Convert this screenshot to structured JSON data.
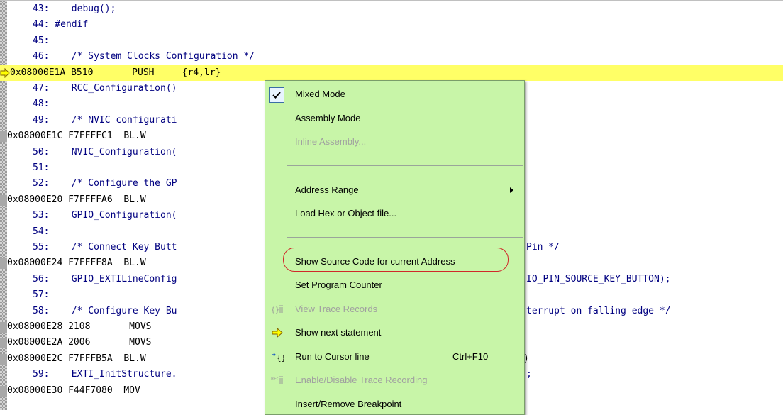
{
  "editor": {
    "lines": [
      {
        "kind": "src",
        "text": "43:    debug();"
      },
      {
        "kind": "src",
        "text": "44: #endif"
      },
      {
        "kind": "src",
        "text": "45:"
      },
      {
        "kind": "src",
        "text": "46:    /* System Clocks Configuration */"
      },
      {
        "kind": "cur",
        "text": "0x08000E1A B510       PUSH     {r4,lr}"
      },
      {
        "kind": "src",
        "text": "47:    RCC_Configuration()"
      },
      {
        "kind": "src",
        "text": "48:"
      },
      {
        "kind": "src",
        "text": "49:    /* NVIC configurati"
      },
      {
        "kind": "asm",
        "text": "0x08000E1C F7FFFFC1  BL.W"
      },
      {
        "kind": "src",
        "text": "50:    NVIC_Configuration("
      },
      {
        "kind": "src",
        "text": "51:"
      },
      {
        "kind": "src",
        "text": "52:    /* Configure the GP"
      },
      {
        "kind": "asm",
        "text": "0x08000E20 F7FFFFA6  BL.W"
      },
      {
        "kind": "src",
        "text": "53:    GPIO_Configuration("
      },
      {
        "kind": "src",
        "text": "54:"
      },
      {
        "kind": "src",
        "text": "55:    /* Connect Key Butt",
        "tail": "Pin */"
      },
      {
        "kind": "asm",
        "text": "0x08000E24 F7FFFF8A  BL.W"
      },
      {
        "kind": "src",
        "text": "56:    GPIO_EXTILineConfig",
        "tail": "IO_PIN_SOURCE_KEY_BUTTON);"
      },
      {
        "kind": "src",
        "text": "57:"
      },
      {
        "kind": "src",
        "text": "58:    /* Configure Key Bu",
        "tail": "terrupt on falling edge */"
      },
      {
        "kind": "asm",
        "text": "0x08000E28 2108       MOVS"
      },
      {
        "kind": "asm",
        "text": "0x08000E2A 2006       MOVS"
      },
      {
        "kind": "asm",
        "text": "0x08000E2C F7FFFB5A  BL.W",
        "tail": ")"
      },
      {
        "kind": "src",
        "text": "59:    EXTI_InitStructure.",
        "tail": ";"
      },
      {
        "kind": "asm",
        "text": "0x08000E30 F44F7080  MOV"
      }
    ]
  },
  "menu": {
    "items": [
      {
        "type": "item",
        "label": "Mixed Mode",
        "checked": true,
        "enabled": true
      },
      {
        "type": "item",
        "label": "Assembly Mode",
        "enabled": true
      },
      {
        "type": "item",
        "label": "Inline Assembly...",
        "enabled": false
      },
      {
        "type": "sep"
      },
      {
        "type": "item",
        "label": "Address Range",
        "submenu": true,
        "enabled": true
      },
      {
        "type": "item",
        "label": "Load Hex or Object file...",
        "enabled": true
      },
      {
        "type": "sep"
      },
      {
        "type": "item",
        "label": "Show Source Code for current Address",
        "enabled": true,
        "circled": true
      },
      {
        "type": "item",
        "label": "Set Program Counter",
        "enabled": true
      },
      {
        "type": "item",
        "label": "View Trace Records",
        "icon": "trace-records-icon",
        "enabled": false
      },
      {
        "type": "item",
        "label": "Show next statement",
        "icon": "next-statement-arrow-icon",
        "enabled": true
      },
      {
        "type": "item",
        "label": "Run to Cursor line",
        "icon": "run-to-cursor-icon",
        "shortcut": "Ctrl+F10",
        "enabled": true
      },
      {
        "type": "item",
        "label": "Enable/Disable Trace Recording",
        "icon": "trace-recording-icon",
        "enabled": false
      },
      {
        "type": "item",
        "label": "Insert/Remove Breakpoint",
        "enabled": true
      }
    ]
  },
  "colors": {
    "current_line": "#ffff66",
    "menu_background": "#c8f5a8",
    "source_text": "#000080",
    "highlight_oval": "#d0282a"
  }
}
